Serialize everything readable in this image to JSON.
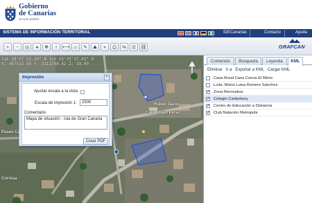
{
  "header": {
    "title_line1": "Gobierno",
    "title_line2": "de Canarias",
    "tagline": "un solo pueblo"
  },
  "navbar": {
    "system_title": "SISTEMA DE INFORMACIÓN TERRITORIAL",
    "languages": [
      "es",
      "en",
      "fr",
      "de",
      "it"
    ],
    "links": [
      {
        "label": "IDECanarias"
      },
      {
        "label": "Contacto"
      },
      {
        "label": "Ayuda"
      }
    ]
  },
  "toolbar": {
    "tools": [
      "zoom-in-icon",
      "zoom-out-icon",
      "zoom-extent-icon",
      "previous-view-icon",
      "pan-icon",
      "info-icon",
      "measure-distance-icon",
      "measure-area-icon",
      "draw-icon",
      "profile-icon",
      "search-coordinates-icon",
      "print-icon",
      "swipe-icon",
      "legend-icon",
      "link-icon"
    ],
    "brand": "GRAFCAN"
  },
  "map": {
    "coords_line1": "lat 28°07'32.39\" N lon 15°25'37.41\" O",
    "coords_line2": "X: 457513.58 Y: 3111398.42 Z: 39.00",
    "streets": [
      "Calle Lujan Pérez",
      "Rubén Darío",
      "Paseo Cornisa",
      "Cornisa"
    ]
  },
  "print_dialog": {
    "title": "Impresión",
    "fit_scale_label": "Ajustar escala a la vista",
    "fit_scale_checked": false,
    "scale_label": "Escala de impresión 1:",
    "scale_value": "2500",
    "comment_label": "Comentario",
    "comment_value": "Mapa de situación - Isla de Gran Canaria",
    "create_pdf_label": "Crear PDF"
  },
  "panel": {
    "tabs": [
      {
        "label": "Contenido",
        "active": false
      },
      {
        "label": "Búsqueda",
        "active": false
      },
      {
        "label": "Leyenda",
        "active": false
      },
      {
        "label": "KML",
        "active": true
      }
    ],
    "kml_actions": [
      "Eliminar",
      "Ir a",
      "Exportar a KML",
      "Cargar KML"
    ],
    "layers": [
      {
        "label": "Casa Rural Casa Cueva El Mimo",
        "checked": false,
        "selected": false
      },
      {
        "label": "Lcda. María Luisa Romero Sánchez",
        "checked": false,
        "selected": false
      },
      {
        "label": "Zona Recreativa",
        "checked": true,
        "selected": false
      },
      {
        "label": "Colegio Canterbury",
        "checked": true,
        "selected": true
      },
      {
        "label": "Centro de Educación a Distancia",
        "checked": true,
        "selected": false
      },
      {
        "label": "Club Natación Metropole",
        "checked": true,
        "selected": false
      }
    ]
  },
  "colors": {
    "brand_blue": "#1f3f7f",
    "panel_border": "#8da0bf",
    "dialog_bg": "#dfe8f6",
    "selection": "#dde7f6"
  }
}
